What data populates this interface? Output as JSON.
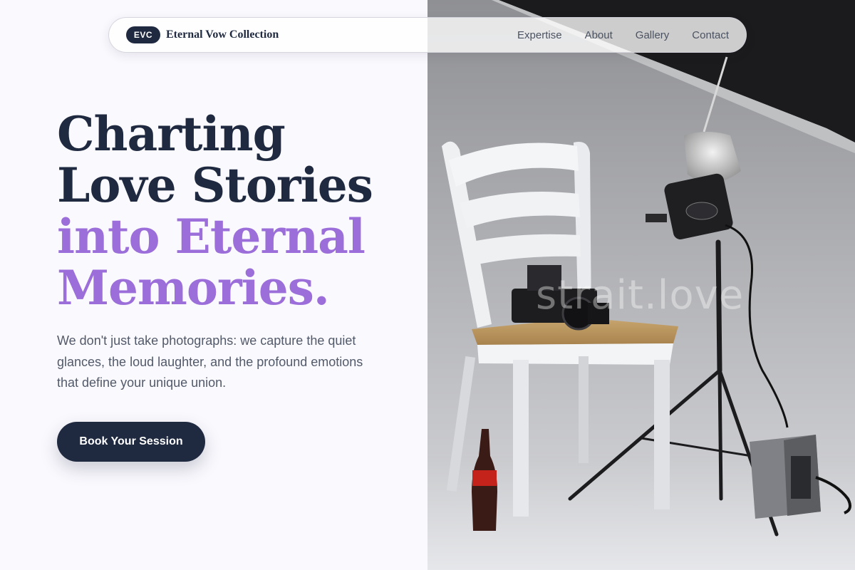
{
  "nav": {
    "brand_badge": "EVC",
    "brand_name": "Eternal Vow Collection",
    "links": [
      "Expertise",
      "About",
      "Gallery",
      "Contact"
    ]
  },
  "hero": {
    "title_line1": "Charting",
    "title_line2": "Love Stories",
    "title_line3": "into Eternal",
    "title_line4": "Memories.",
    "subtitle": "We don't just take photographs: we capture the quiet glances, the loud laughter, and the profound emotions that define your unique union.",
    "cta_label": "Book Your Session"
  },
  "photo": {
    "watermark": "strait.love",
    "description_icon": "studio-photo"
  },
  "colors": {
    "primary_dark": "#1f2a40",
    "accent_purple": "#9b6ed9",
    "page_bg": "#faf9fe"
  }
}
